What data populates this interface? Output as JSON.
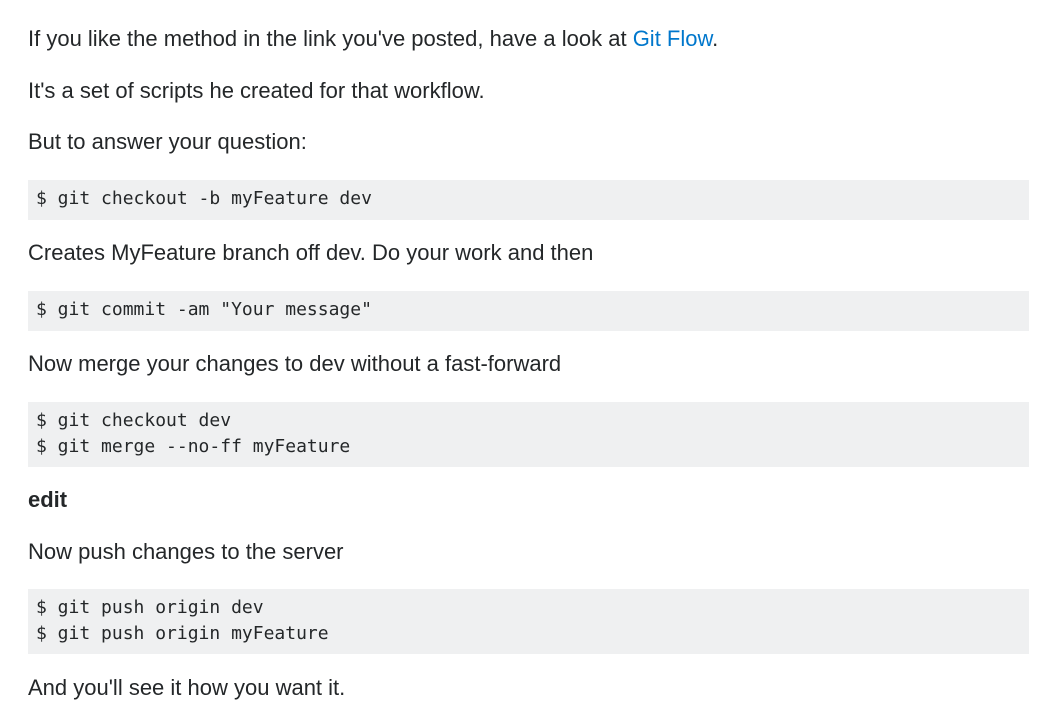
{
  "answer": {
    "p1_before_link": "If you like the method in the link you've posted, have a look at ",
    "p1_link": "Git Flow",
    "p1_after_link": ".",
    "p2": "It's a set of scripts he created for that workflow.",
    "p3": "But to answer your question:",
    "code1": "$ git checkout -b myFeature dev",
    "p4": "Creates MyFeature branch off dev. Do your work and then",
    "code2": "$ git commit -am \"Your message\"",
    "p5": "Now merge your changes to dev without a fast-forward",
    "code3": "$ git checkout dev\n$ git merge --no-ff myFeature",
    "edit_label": "edit",
    "p6": "Now push changes to the server",
    "code4": "$ git push origin dev\n$ git push origin myFeature",
    "p7": "And you'll see it how you want it."
  },
  "colors": {
    "text": "#242729",
    "link": "#0077cc",
    "code_background": "#eff0f1"
  }
}
